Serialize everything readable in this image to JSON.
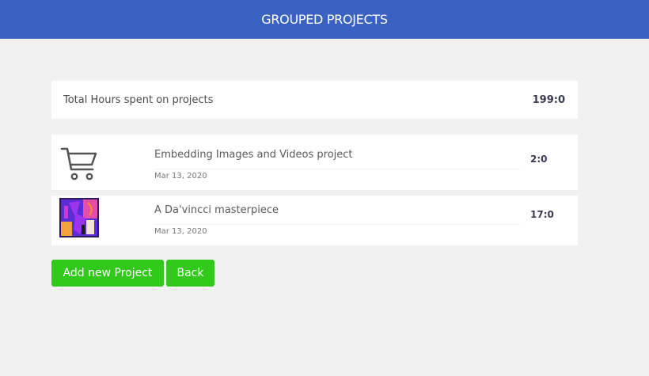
{
  "header": {
    "title": "GROUPED PROJECTS"
  },
  "summary": {
    "label": "Total Hours spent on projects",
    "value": "199:0"
  },
  "projects": [
    {
      "title": "Embedding Images and Videos project",
      "date": "Mar 13, 2020",
      "hours": "2:0",
      "thumbnail": "cart-icon"
    },
    {
      "title": "A Da'vincci masterpiece",
      "date": "Mar 13, 2020",
      "hours": "17:0",
      "thumbnail": "abstract-art-thumbnail"
    }
  ],
  "actions": {
    "add_label": "Add new Project",
    "back_label": "Back"
  },
  "colors": {
    "header_bg": "#3a62c2",
    "button_bg": "#33c91c",
    "page_bg": "#f0f1f0"
  }
}
